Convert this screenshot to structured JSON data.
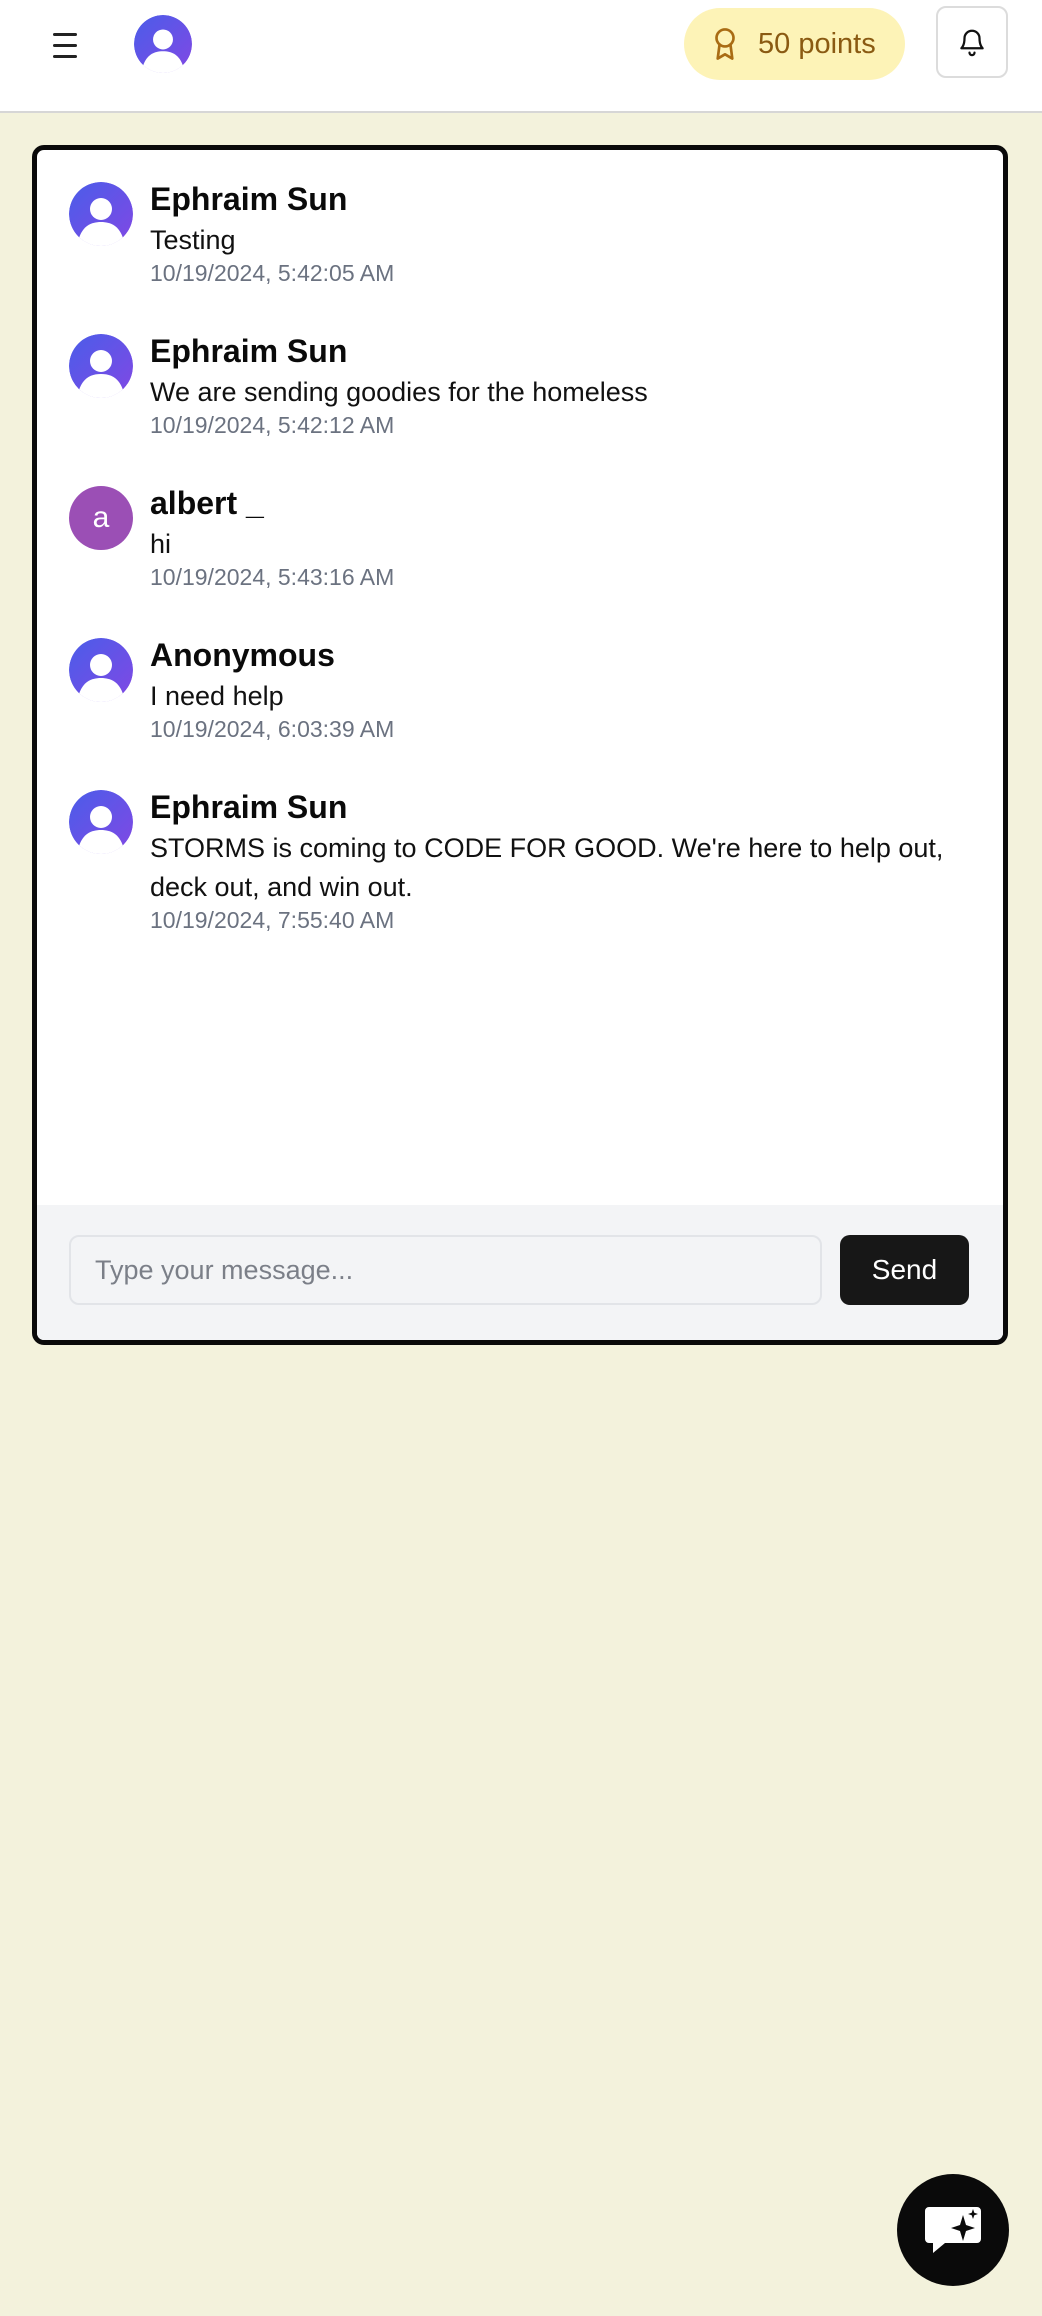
{
  "header": {
    "menu_icon": "hamburger-menu-icon",
    "avatar_icon": "user-avatar-icon",
    "points_label": "50 points",
    "points_icon": "award-ribbon-icon",
    "notifications_icon": "bell-icon"
  },
  "messages": [
    {
      "author": "Ephraim Sun",
      "text": "Testing",
      "timestamp": "10/19/2024, 5:42:05 AM",
      "avatar": "default-user-avatar"
    },
    {
      "author": "Ephraim Sun",
      "text": "We are sending goodies for the homeless",
      "timestamp": "10/19/2024, 5:42:12 AM",
      "avatar": "default-user-avatar"
    },
    {
      "author": "albert _",
      "text": "hi",
      "timestamp": "10/19/2024, 5:43:16 AM",
      "avatar_letter": "a"
    },
    {
      "author": "Anonymous",
      "text": "I need help",
      "timestamp": "10/19/2024, 6:03:39 AM",
      "avatar": "default-user-avatar"
    },
    {
      "author": "Ephraim Sun",
      "text": "STORMS is coming to CODE FOR GOOD. We're here to help out, deck out, and win out.",
      "timestamp": "10/19/2024, 7:55:40 AM",
      "avatar": "default-user-avatar"
    }
  ],
  "composer": {
    "placeholder": "Type your message...",
    "value": "",
    "send_label": "Send"
  },
  "fab": {
    "icon": "ai-chat-sparkle-icon"
  },
  "colors": {
    "page_background": "#f3f2dc",
    "points_background": "#fdf3b7",
    "points_text": "#8a5a12",
    "avatar_gradient_start": "#4f5bea",
    "avatar_gradient_end": "#7a4de6",
    "letter_avatar": "#9b4fb5",
    "send_button": "#171717"
  }
}
